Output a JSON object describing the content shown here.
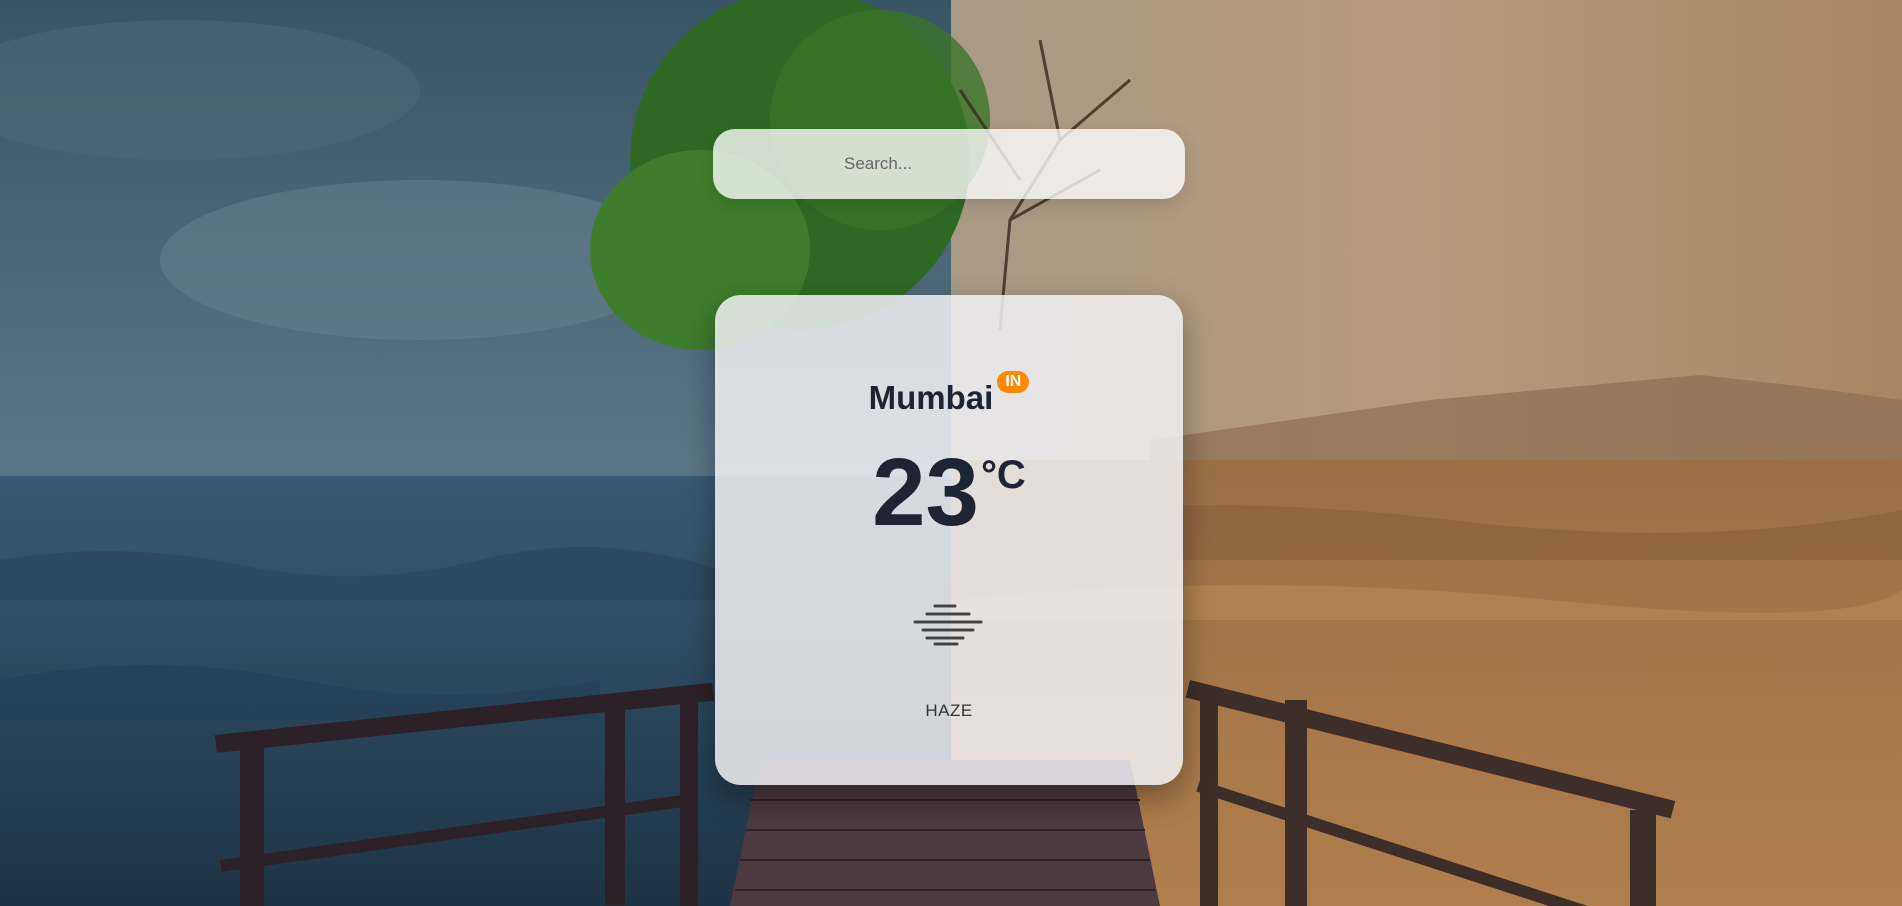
{
  "search": {
    "placeholder": "Search...",
    "value": ""
  },
  "weather": {
    "city": "Mumbai",
    "country": "IN",
    "temperature": "23",
    "unit": "°C",
    "condition": "HAZE",
    "icon": "haze-icon"
  },
  "colors": {
    "badge": "#ff8a00",
    "text_dark": "#1e2433"
  }
}
